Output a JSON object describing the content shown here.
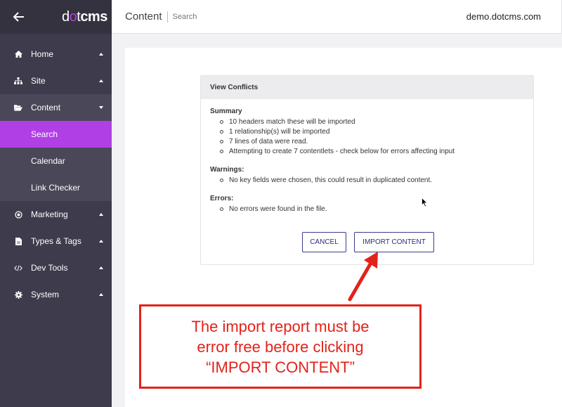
{
  "sidebar": {
    "logo_parts": [
      "d",
      "o",
      "t",
      "cms"
    ],
    "items": [
      {
        "label": "Home",
        "icon": "home-icon"
      },
      {
        "label": "Site",
        "icon": "sitemap-icon"
      },
      {
        "label": "Content",
        "icon": "folder-open-icon"
      },
      {
        "label": "Marketing",
        "icon": "bullseye-icon"
      },
      {
        "label": "Types & Tags",
        "icon": "file-icon"
      },
      {
        "label": "Dev Tools",
        "icon": "code-icon"
      },
      {
        "label": "System",
        "icon": "gear-icon"
      }
    ],
    "content_sub": [
      {
        "label": "Search"
      },
      {
        "label": "Calendar"
      },
      {
        "label": "Link Checker"
      }
    ]
  },
  "header": {
    "title": "Content",
    "crumb": "Search",
    "host": "demo.dotcms.com"
  },
  "dialog": {
    "title": "View Conflicts",
    "summary_title": "Summary",
    "summary_items": [
      "10 headers match these will be imported",
      "1 relationship(s) will be imported",
      "7 lines of data were read.",
      "Attempting to create 7 contentlets - check below for errors affecting input"
    ],
    "warnings_title": "Warnings:",
    "warnings_items": [
      "No key fields were chosen, this could result in duplicated content."
    ],
    "errors_title": "Errors:",
    "errors_items": [
      "No errors were found in the file."
    ],
    "cancel_label": "CANCEL",
    "import_label": "IMPORT CONTENT"
  },
  "annotation": {
    "line1": "The import report must be",
    "line2": "error free before clicking",
    "line3": "“IMPORT CONTENT”"
  },
  "colors": {
    "sidebar_bg": "#3d3b4c",
    "accent": "#b13fe6",
    "annotation_red": "#e2231a",
    "button_border": "#3b3b8c"
  }
}
